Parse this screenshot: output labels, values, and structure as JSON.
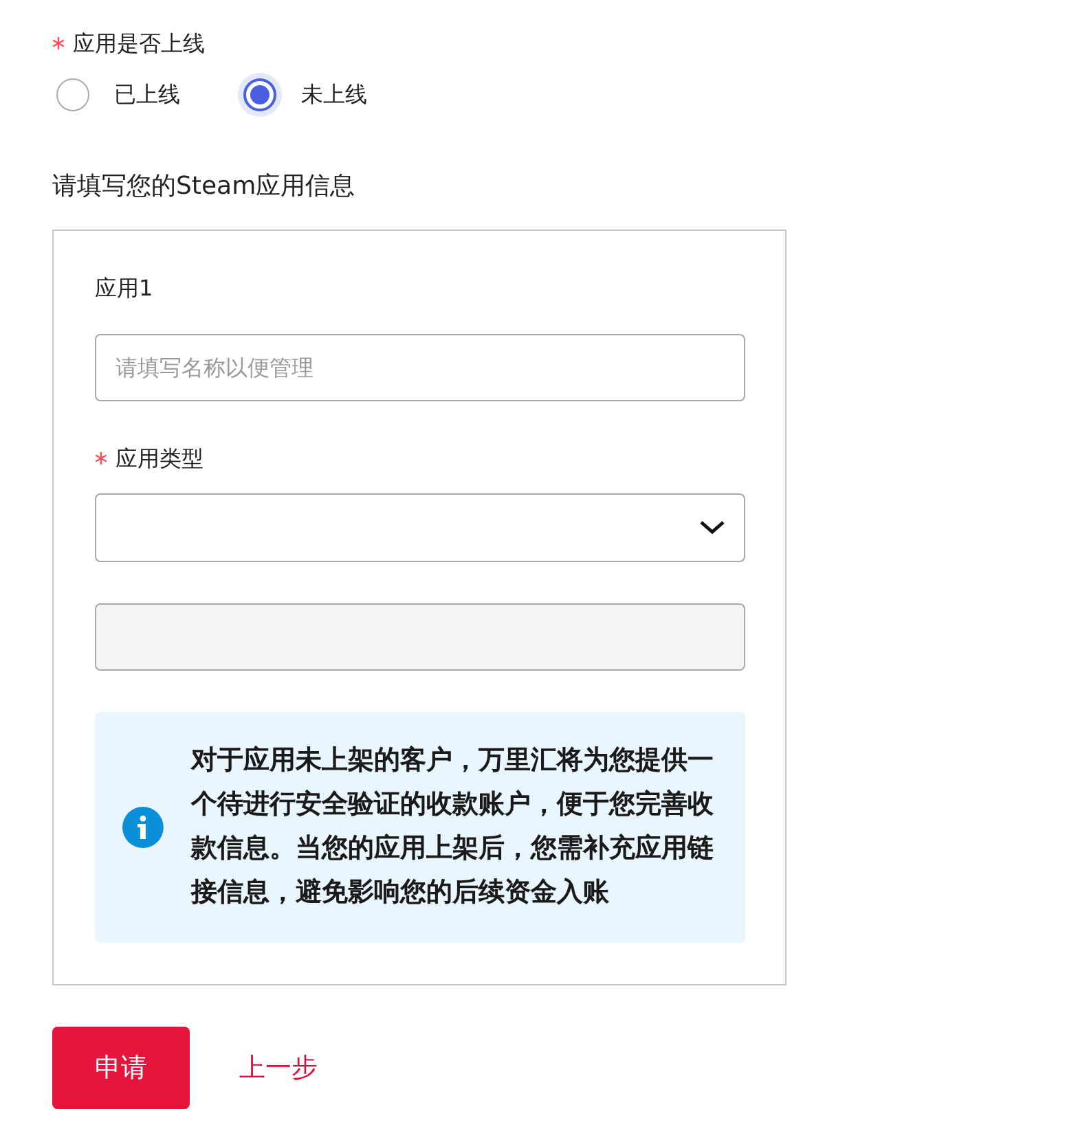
{
  "online_question": {
    "label": "应用是否上线",
    "required": true,
    "options": [
      {
        "label": "已上线",
        "selected": false
      },
      {
        "label": "未上线",
        "selected": true
      }
    ]
  },
  "section_title": "请填写您的Steam应用信息",
  "app_card": {
    "title": "应用1",
    "name_field": {
      "placeholder": "请填写名称以便管理"
    },
    "type_field": {
      "label": "应用类型",
      "required": true
    },
    "disabled_field": {
      "disabled": true
    },
    "notice": "对于应用未上架的客户，万里汇将为您提供一个待进行安全验证的收款账户，便于您完善收款信息。当您的应用上架后，您需补充应用链接信息，避免影响您的后续资金入账"
  },
  "buttons": [
    {
      "label": "申请",
      "kind": "primary"
    },
    {
      "label": "上一步",
      "kind": "link"
    }
  ]
}
